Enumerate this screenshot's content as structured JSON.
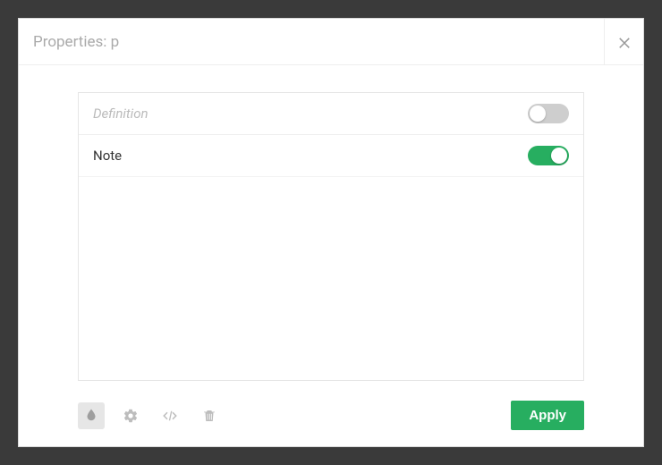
{
  "dialog": {
    "title": "Properties: p"
  },
  "rows": [
    {
      "label": "Definition",
      "on": false,
      "disabled": true
    },
    {
      "label": "Note",
      "on": true,
      "disabled": false
    }
  ],
  "footer": {
    "apply_label": "Apply"
  }
}
